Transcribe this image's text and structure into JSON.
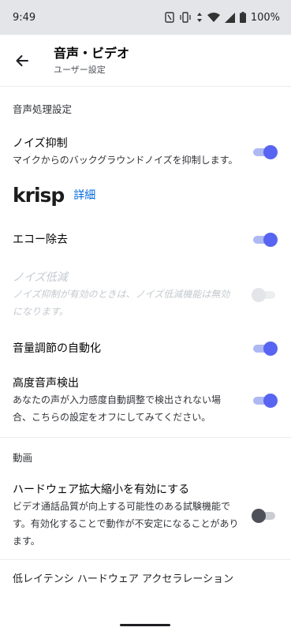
{
  "status_bar": {
    "time": "9:49",
    "battery": "100%"
  },
  "header": {
    "title": "音声・ビデオ",
    "subtitle": "ユーザー設定"
  },
  "sections": {
    "voice_processing": {
      "header": "音声処理設定",
      "noise_suppression": {
        "title": "ノイズ抑制",
        "description": "マイクからのバックグラウンドノイズを抑制します。",
        "enabled": true
      },
      "krisp": {
        "logo": "krisp",
        "link": "詳細"
      },
      "echo_cancellation": {
        "title": "エコー除去",
        "enabled": true
      },
      "noise_reduction": {
        "title": "ノイズ低減",
        "description": "ノイズ抑制が有効のときは、ノイズ低減機能は無効になります。",
        "enabled": false,
        "disabled": true
      },
      "auto_gain": {
        "title": "音量調節の自動化",
        "enabled": true
      },
      "advanced_vad": {
        "title": "高度音声検出",
        "description": "あなたの声が入力感度自動調整で検出されない場合、こちらの設定をオフにしてみてください。",
        "enabled": true
      }
    },
    "video": {
      "header": "動画",
      "hardware_scaling": {
        "title": "ハードウェア拡大縮小を有効にする",
        "description": "ビデオ通話品質が向上する可能性のある試験機能です。有効化することで動作が不安定になることがあります。",
        "enabled": false
      },
      "low_latency_header": "低レイテンシ ハードウェア アクセラレーション"
    }
  },
  "colors": {
    "accent": "#5865f2",
    "link": "#0068e0"
  }
}
